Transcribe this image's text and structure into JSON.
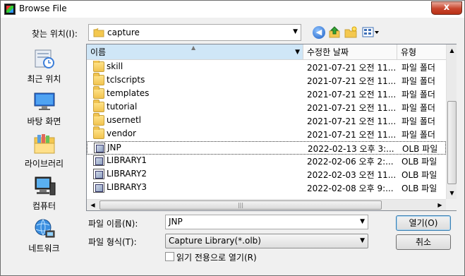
{
  "window": {
    "title": "Browse File",
    "close_glyph": "x"
  },
  "lookin": {
    "label": "찾는 위치(I):",
    "value": "capture"
  },
  "toolbar_icons": [
    "back-icon",
    "up-folder-icon",
    "new-folder-icon",
    "views-menu-icon"
  ],
  "places": [
    {
      "label": "최근 위치",
      "icon": "recent-places-icon"
    },
    {
      "label": "바탕 화면",
      "icon": "desktop-icon"
    },
    {
      "label": "라이브러리",
      "icon": "libraries-icon"
    },
    {
      "label": "컴퓨터",
      "icon": "computer-icon"
    },
    {
      "label": "네트워크",
      "icon": "network-icon"
    }
  ],
  "columns": {
    "name": "이름",
    "date": "수정한 날짜",
    "type": "유형"
  },
  "files": [
    {
      "name": "skill",
      "date": "2021-07-21 오전 11...",
      "type": "파일 폴더",
      "kind": "folder"
    },
    {
      "name": "tclscripts",
      "date": "2021-07-21 오전 11...",
      "type": "파일 폴더",
      "kind": "folder"
    },
    {
      "name": "templates",
      "date": "2021-07-21 오전 11...",
      "type": "파일 폴더",
      "kind": "folder"
    },
    {
      "name": "tutorial",
      "date": "2021-07-21 오전 11...",
      "type": "파일 폴더",
      "kind": "folder"
    },
    {
      "name": "usernetl",
      "date": "2021-07-21 오전 11...",
      "type": "파일 폴더",
      "kind": "folder"
    },
    {
      "name": "vendor",
      "date": "2021-07-21 오전 11...",
      "type": "파일 폴더",
      "kind": "folder"
    },
    {
      "name": "JNP",
      "date": "2022-02-13 오후 3:...",
      "type": "OLB 파일",
      "kind": "olb",
      "selected": true
    },
    {
      "name": "LIBRARY1",
      "date": "2022-02-06 오후 2:...",
      "type": "OLB 파일",
      "kind": "olb"
    },
    {
      "name": "LIBRARY2",
      "date": "2022-02-03 오전 11...",
      "type": "OLB 파일",
      "kind": "olb"
    },
    {
      "name": "LIBRARY3",
      "date": "2022-02-08 오후 9:...",
      "type": "OLB 파일",
      "kind": "olb"
    }
  ],
  "filename": {
    "label": "파일 이름(N):",
    "value": "JNP"
  },
  "filetype": {
    "label": "파일 형식(T):",
    "value": "Capture Library(*.olb)"
  },
  "readonly_label": "읽기 전용으로 열기(R)",
  "buttons": {
    "open": "열기(O)",
    "cancel": "취소"
  }
}
